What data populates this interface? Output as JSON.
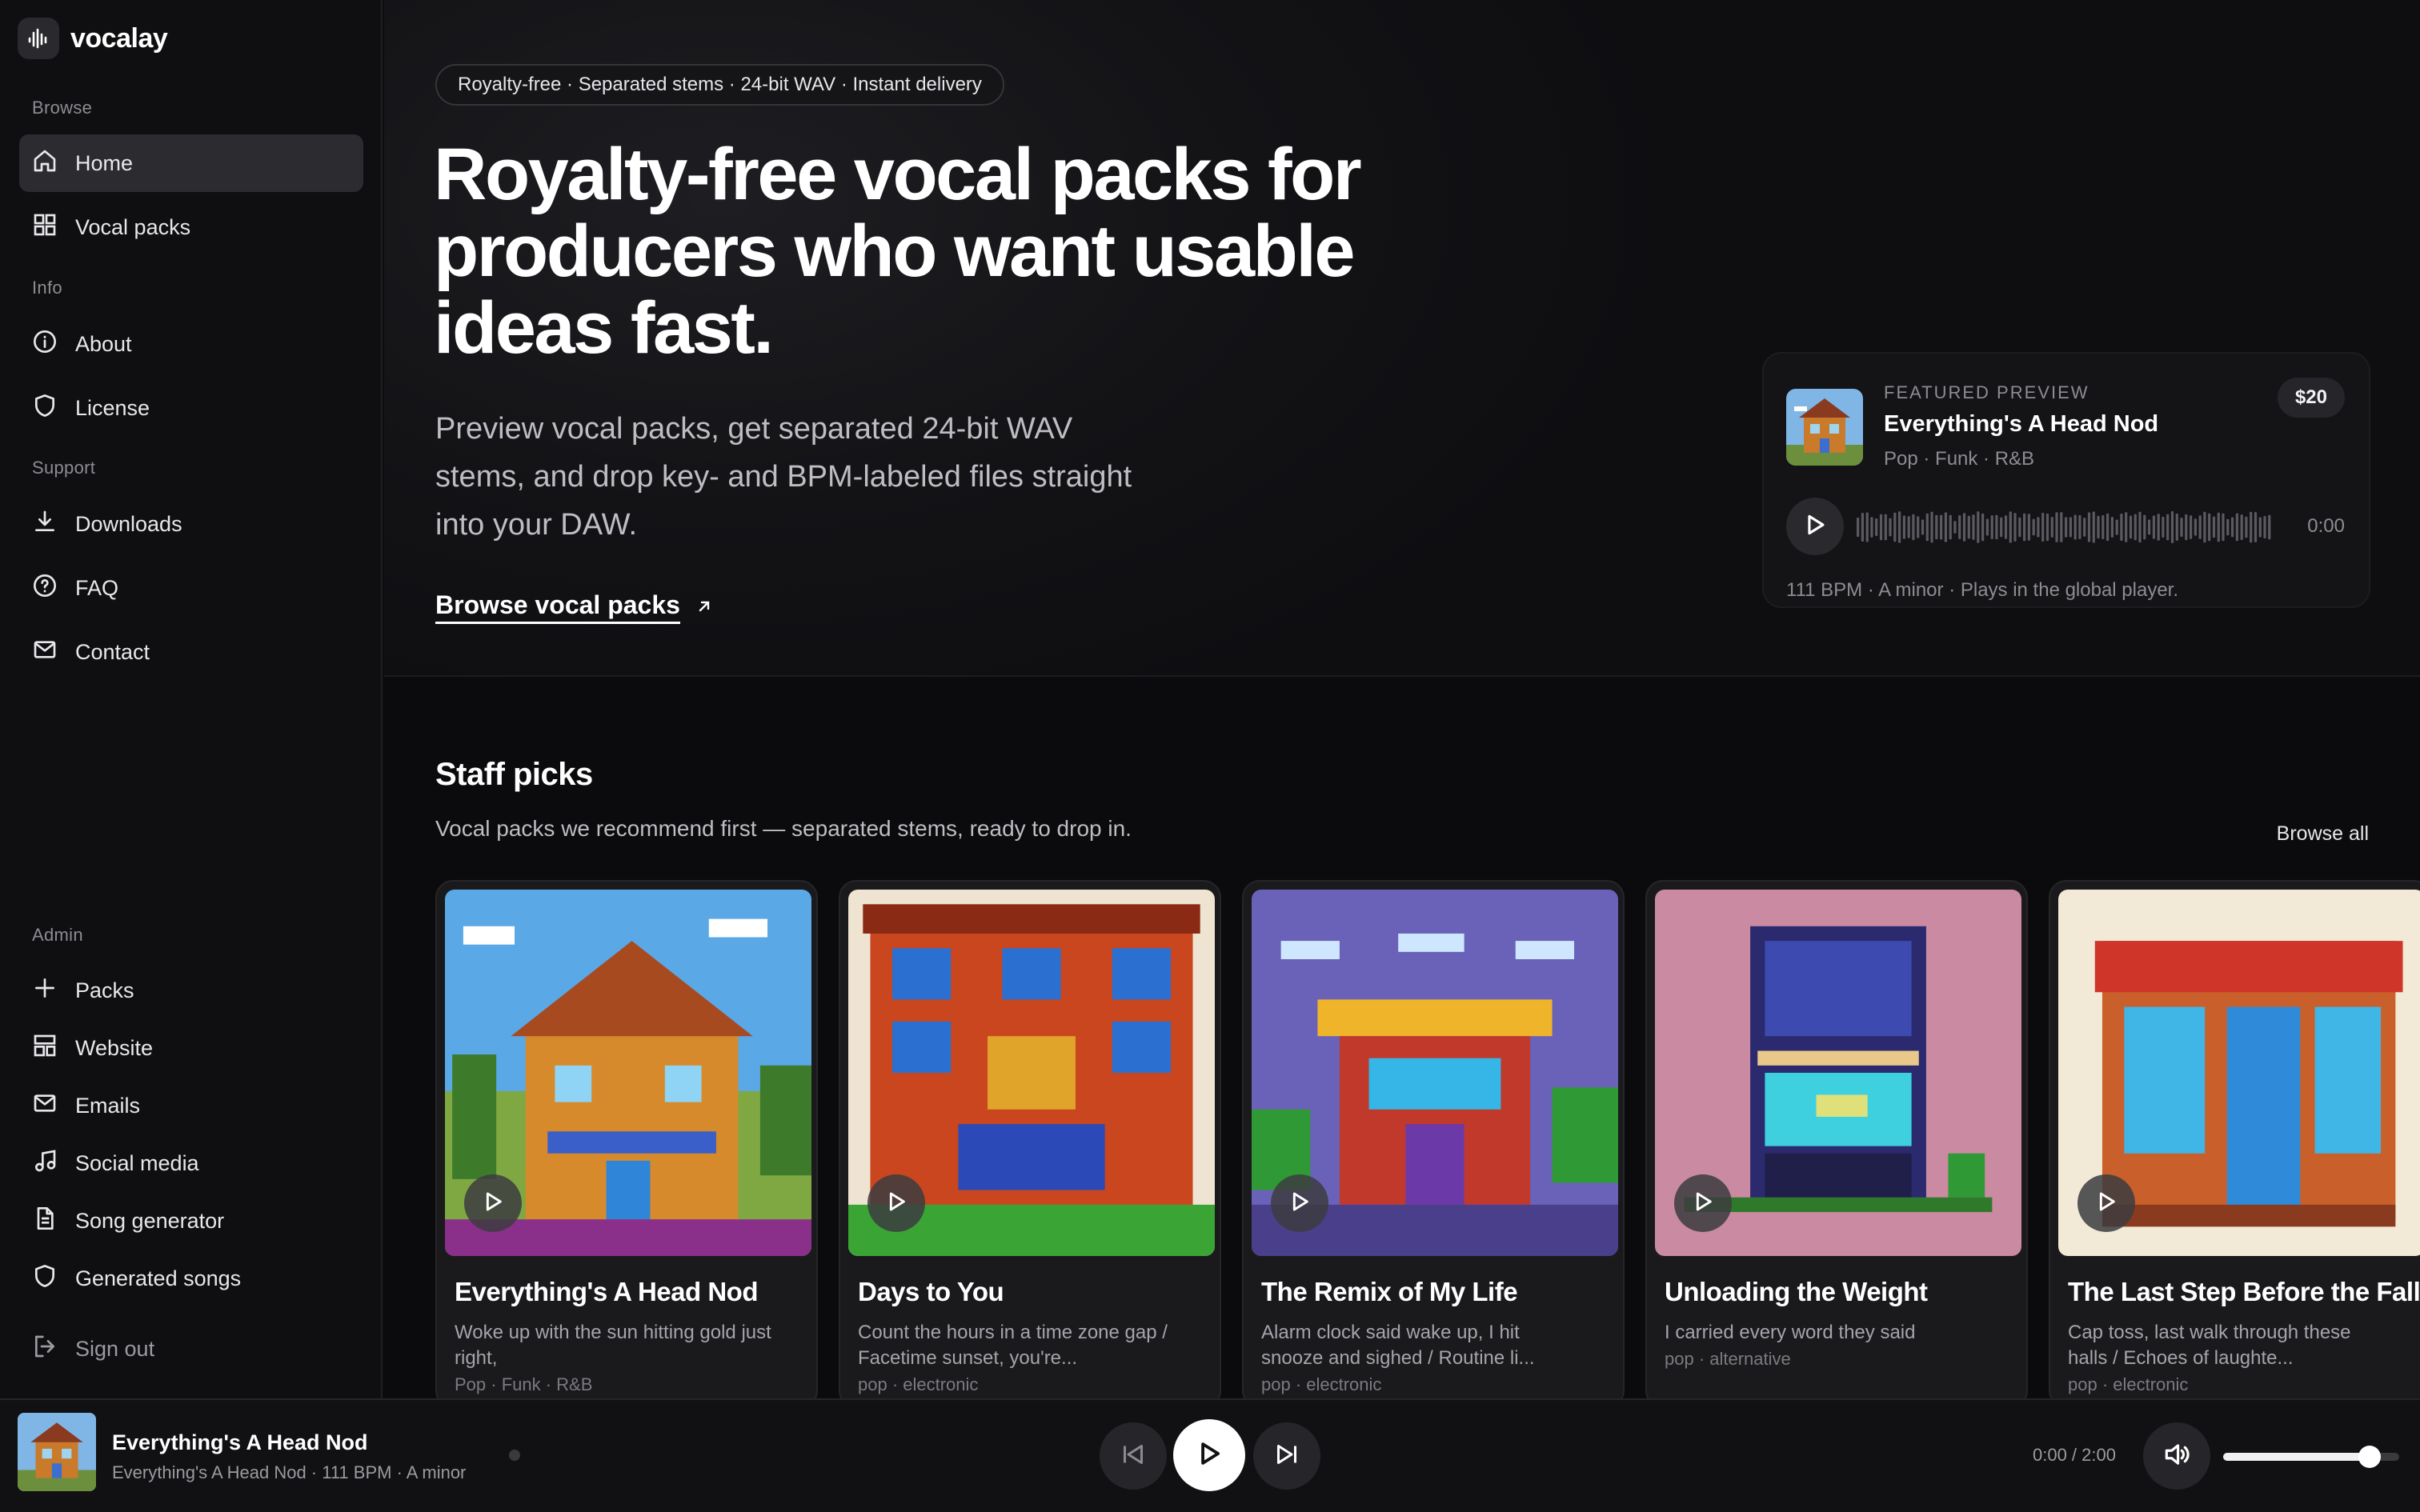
{
  "app": {
    "name": "vocalay"
  },
  "sidebar": {
    "sections": {
      "browse": "Browse",
      "info": "Info",
      "support": "Support",
      "admin": "Admin"
    },
    "browse_items": [
      {
        "label": "Home",
        "icon": "home-icon",
        "active": true
      },
      {
        "label": "Vocal packs",
        "icon": "grid-icon"
      }
    ],
    "info_items": [
      {
        "label": "About",
        "icon": "info-icon"
      },
      {
        "label": "License",
        "icon": "shield-icon"
      }
    ],
    "support_items": [
      {
        "label": "Downloads",
        "icon": "download-icon"
      },
      {
        "label": "FAQ",
        "icon": "help-icon"
      },
      {
        "label": "Contact",
        "icon": "mail-icon"
      }
    ],
    "admin_items": [
      {
        "label": "Packs",
        "icon": "plus-icon"
      },
      {
        "label": "Website",
        "icon": "layout-icon"
      },
      {
        "label": "Emails",
        "icon": "mail-icon"
      },
      {
        "label": "Social media",
        "icon": "music-note-icon"
      },
      {
        "label": "Song generator",
        "icon": "document-icon"
      },
      {
        "label": "Generated songs",
        "icon": "shield-icon"
      }
    ],
    "sign_out": "Sign out"
  },
  "hero": {
    "pill": "Royalty-free · Separated stems · 24-bit WAV · Instant delivery",
    "title": "Royalty-free vocal packs for producers who want usable ideas fast.",
    "subtitle": "Preview vocal packs, get separated 24-bit WAV stems, and drop key- and BPM-labeled files straight into your DAW.",
    "cta": "Browse vocal packs"
  },
  "featured": {
    "kicker": "FEATURED PREVIEW",
    "title": "Everything's A Head Nod",
    "tags": "Pop · Funk · R&B",
    "price": "$20",
    "time": "0:00",
    "meta": "111 BPM · A minor · Plays in the global player."
  },
  "staff_picks": {
    "title": "Staff picks",
    "subtitle": "Vocal packs we recommend first — separated stems, ready to drop in.",
    "browse_all": "Browse all",
    "cards": [
      {
        "title": "Everything's A Head Nod",
        "desc": "Woke up with the sun hitting gold just right,",
        "tags": "Pop · Funk · R&B"
      },
      {
        "title": "Days to You",
        "desc": "Count the hours in a time zone gap / Facetime sunset, you're...",
        "tags": "pop · electronic"
      },
      {
        "title": "The Remix of My Life",
        "desc": "Alarm clock said wake up, I hit snooze and sighed / Routine li...",
        "tags": "pop · electronic"
      },
      {
        "title": "Unloading the Weight",
        "desc": "I carried every word they said",
        "tags": "pop · alternative"
      },
      {
        "title": "The Last Step Before the Fall",
        "desc": "Cap toss, last walk through these halls / Echoes of laughte...",
        "tags": "pop · electronic"
      }
    ]
  },
  "player": {
    "title": "Everything's A Head Nod",
    "subtitle": "Everything's A Head Nod · 111 BPM · A minor",
    "time": "0:00 / 2:00",
    "volume": 0.83
  },
  "colors": {
    "accent": "#ffffff",
    "background": "#0b0b0d",
    "card": "#1a1a1d"
  }
}
